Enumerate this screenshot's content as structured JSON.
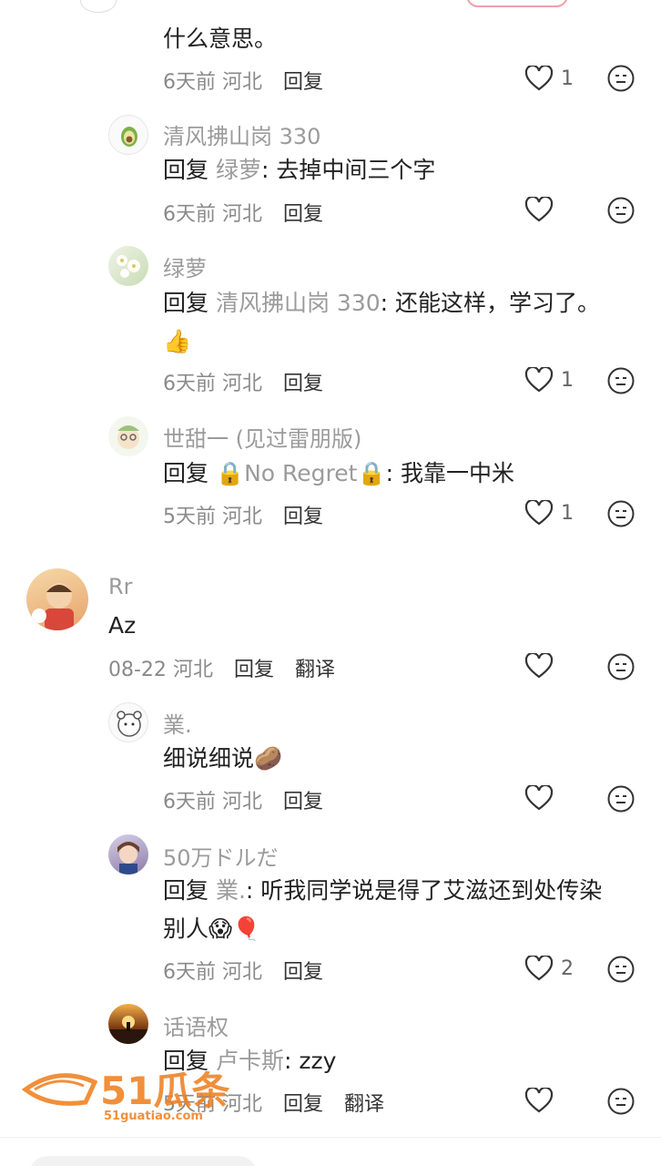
{
  "comments": [
    {
      "body": "什么意思。",
      "time": "6天前",
      "region": "河北",
      "reply_label": "回复",
      "likes": "1"
    },
    {
      "name": "清风拂山岗 330",
      "reply_prefix": "回复",
      "reply_to": "绿萝",
      "text": ": 去掉中间三个字",
      "time": "6天前",
      "region": "河北",
      "reply_label": "回复",
      "likes": ""
    },
    {
      "name": "绿萝",
      "reply_prefix": "回复",
      "reply_to": "清风拂山岗 330",
      "text": ": 还能这样，学习了。",
      "emoji": "👍",
      "time": "6天前",
      "region": "河北",
      "reply_label": "回复",
      "likes": "1"
    },
    {
      "name": "世甜一 (见过雷朋版)",
      "reply_prefix": "回复",
      "reply_to": "🔒No Regret🔒",
      "text": ": 我靠一中米",
      "time": "5天前",
      "region": "河北",
      "reply_label": "回复",
      "likes": "1"
    },
    {
      "name": "Rr",
      "text": "Az",
      "time": "08-22",
      "region": "河北",
      "reply_label": "回复",
      "translate_label": "翻译",
      "likes": ""
    },
    {
      "name": "業.",
      "text": "细说细说🥔",
      "time": "6天前",
      "region": "河北",
      "reply_label": "回复",
      "likes": ""
    },
    {
      "name": "50万ドルだ",
      "reply_prefix": "回复",
      "reply_to": "業.",
      "text": ": 听我同学说是得了艾滋还到处传染",
      "text2": "别人😱🎈",
      "time": "6天前",
      "region": "河北",
      "reply_label": "回复",
      "likes": "2"
    },
    {
      "name": "话语权",
      "reply_prefix": "回复",
      "reply_to": "卢卡斯",
      "text": ": zzy",
      "time": "5天前",
      "region": "河北",
      "reply_label": "回复",
      "translate_label": "翻译",
      "likes": ""
    }
  ],
  "watermark": {
    "brand": "51瓜条",
    "url": "51guatiao.com"
  },
  "colors": {
    "accent": "#f08020",
    "muted": "#9b9b9b",
    "text": "#222222"
  },
  "icons": {
    "like": "heart-outline-icon",
    "react": "neutral-face-icon"
  }
}
